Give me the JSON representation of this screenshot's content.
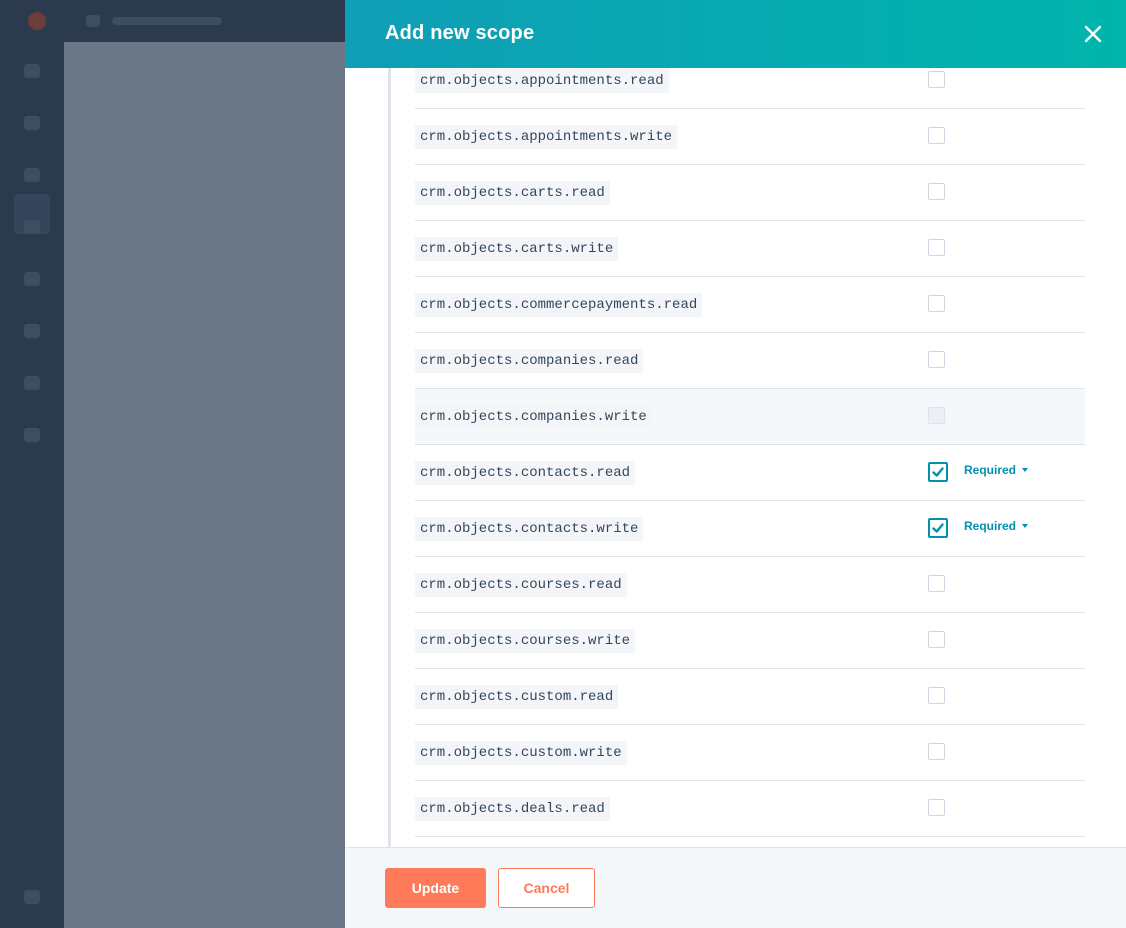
{
  "panel": {
    "title": "Add new scope",
    "close_icon": "close-icon"
  },
  "scopes": [
    {
      "name": "crm.objects.appointments.read",
      "checked": false,
      "disabled": false,
      "requirement": ""
    },
    {
      "name": "crm.objects.appointments.write",
      "checked": false,
      "disabled": false,
      "requirement": ""
    },
    {
      "name": "crm.objects.carts.read",
      "checked": false,
      "disabled": false,
      "requirement": ""
    },
    {
      "name": "crm.objects.carts.write",
      "checked": false,
      "disabled": false,
      "requirement": ""
    },
    {
      "name": "crm.objects.commercepayments.read",
      "checked": false,
      "disabled": false,
      "requirement": ""
    },
    {
      "name": "crm.objects.companies.read",
      "checked": false,
      "disabled": false,
      "requirement": ""
    },
    {
      "name": "crm.objects.companies.write",
      "checked": false,
      "disabled": true,
      "requirement": ""
    },
    {
      "name": "crm.objects.contacts.read",
      "checked": true,
      "disabled": false,
      "requirement": "Required"
    },
    {
      "name": "crm.objects.contacts.write",
      "checked": true,
      "disabled": false,
      "requirement": "Required"
    },
    {
      "name": "crm.objects.courses.read",
      "checked": false,
      "disabled": false,
      "requirement": ""
    },
    {
      "name": "crm.objects.courses.write",
      "checked": false,
      "disabled": false,
      "requirement": ""
    },
    {
      "name": "crm.objects.custom.read",
      "checked": false,
      "disabled": false,
      "requirement": ""
    },
    {
      "name": "crm.objects.custom.write",
      "checked": false,
      "disabled": false,
      "requirement": ""
    },
    {
      "name": "crm.objects.deals.read",
      "checked": false,
      "disabled": false,
      "requirement": ""
    }
  ],
  "footer": {
    "update_label": "Update",
    "cancel_label": "Cancel"
  },
  "colors": {
    "header_start": "#0f9eb6",
    "header_end": "#00b5ac",
    "accent_orange": "#ff7a59",
    "checkbox_teal": "#0091ae",
    "overlay": "#5f6b79"
  }
}
